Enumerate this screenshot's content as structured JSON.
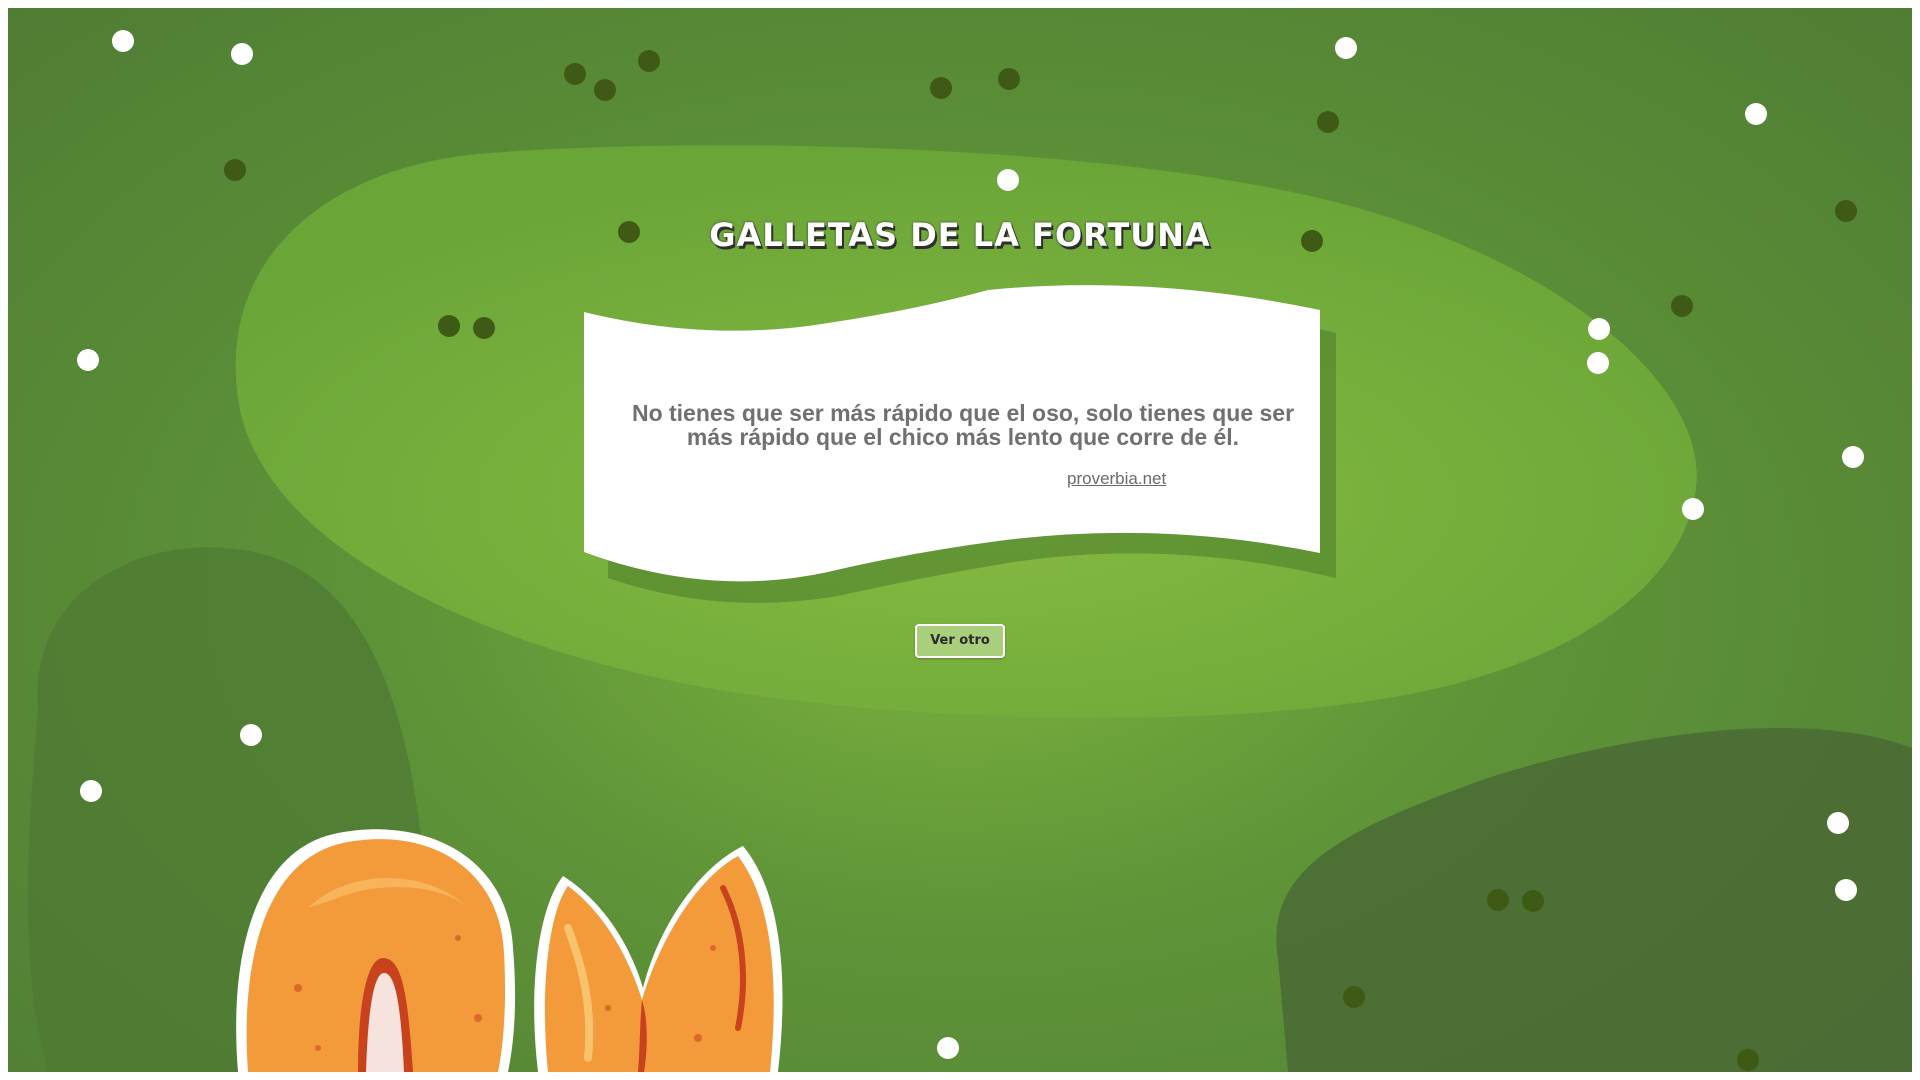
{
  "page": {
    "title": "Galletas de la fortuna"
  },
  "fortune": {
    "quote": "No tienes que ser más rápido que el oso, solo tienes que ser más rápido que el chico más lento que corre de él.",
    "source": "proverbia.net"
  },
  "actions": {
    "next_label": "Ver otro"
  },
  "colors": {
    "background": "#5f9438",
    "center_blob": "#7cb33e",
    "dark_blob": "#4a6b35",
    "card": "#ffffff",
    "button": "#a9cf7c",
    "cookie": "#f39a3b",
    "dots_light": "#ffffff",
    "dots_dark": "#3f5a14"
  }
}
